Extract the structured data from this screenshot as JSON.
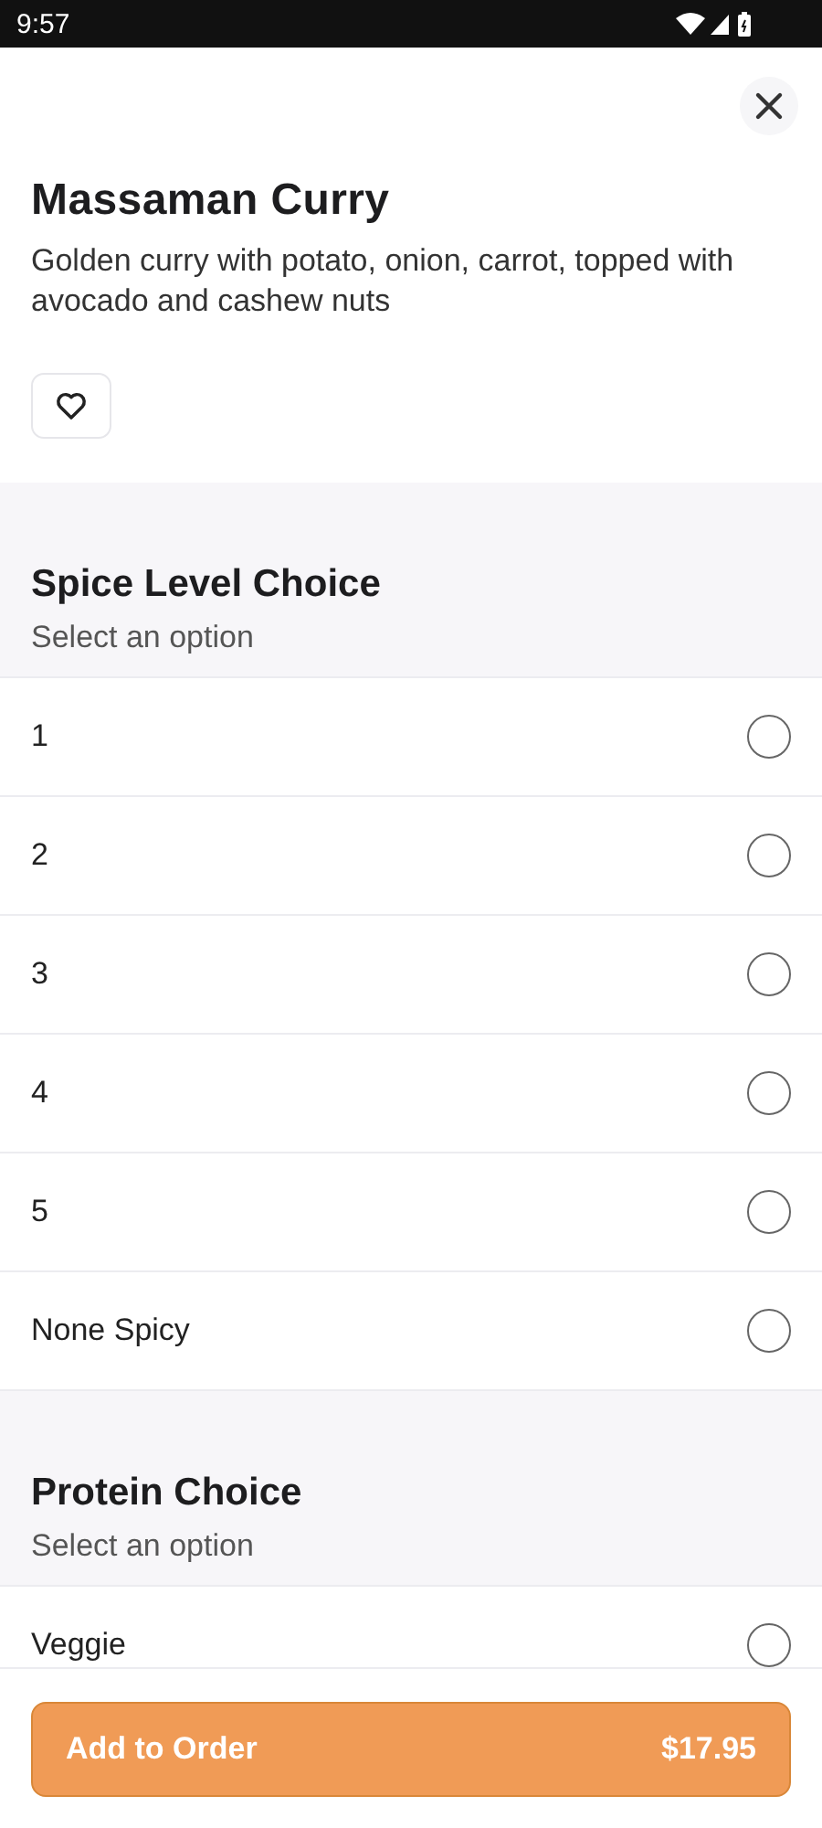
{
  "status_bar": {
    "time": "9:57"
  },
  "item": {
    "title": "Massaman Curry",
    "description": "Golden curry with potato, onion, carrot, topped with avocado and cashew nuts",
    "favorite": false
  },
  "option_groups": [
    {
      "title": "Spice Level Choice",
      "subtitle": "Select an option",
      "options": [
        {
          "label": "1",
          "selected": false
        },
        {
          "label": "2",
          "selected": false
        },
        {
          "label": "3",
          "selected": false
        },
        {
          "label": "4",
          "selected": false
        },
        {
          "label": "5",
          "selected": false
        },
        {
          "label": "None Spicy",
          "selected": false
        }
      ]
    },
    {
      "title": "Protein Choice",
      "subtitle": "Select an option",
      "options": [
        {
          "label": "Veggie",
          "selected": false
        }
      ]
    }
  ],
  "footer": {
    "button_label": "Add to Order",
    "price": "$17.95"
  }
}
